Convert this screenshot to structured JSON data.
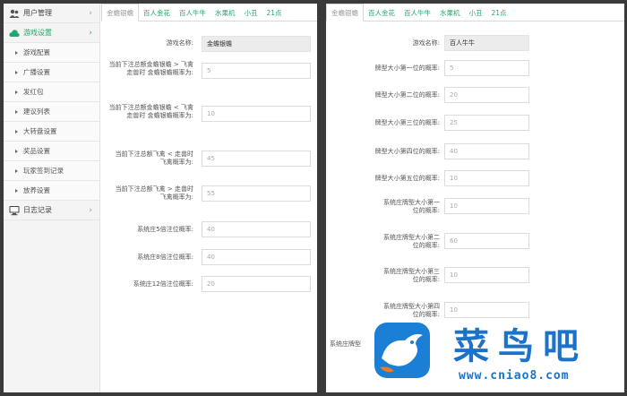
{
  "sidebar": {
    "items": [
      {
        "label": "用户管理",
        "icon": "users-icon"
      },
      {
        "label": "游戏设置",
        "icon": "cloud-icon",
        "active": true
      },
      {
        "label": "日志记录",
        "icon": "monitor-icon"
      }
    ],
    "sub_items": [
      "游戏配置",
      "广播设置",
      "发红包",
      "建议列表",
      "大转盘设置",
      "奖品设置",
      "玩家签到记录",
      "放养设置"
    ]
  },
  "left_panel": {
    "tabs": [
      "金蟾银蟾",
      "百人金花",
      "百人牛牛",
      "水果机",
      "小丑",
      "21点"
    ],
    "active_tab": 0,
    "fields": [
      {
        "label": "游戏名称:",
        "value": "金蟾银蟾",
        "readonly": true
      },
      {
        "label": "当前下注总额金蟾银蟾 > 飞禽走兽时 金蟾银蟾概率为:",
        "value": "5"
      },
      {
        "label": "当前下注总额金蟾银蟾 < 飞禽走兽时 金蟾银蟾概率为:",
        "value": "10"
      },
      {
        "label": "当前下注总额飞禽 < 走兽时 飞禽概率为:",
        "value": "45"
      },
      {
        "label": "当前下注总额飞禽 > 走兽时 飞禽概率为:",
        "value": "55"
      },
      {
        "label": "系统庄5倍注位概率:",
        "value": "40"
      },
      {
        "label": "系统庄8倍注位概率:",
        "value": "40"
      },
      {
        "label": "系统庄12倍注位概率:",
        "value": "20"
      }
    ]
  },
  "right_panel": {
    "tabs": [
      "金蟾银蟾",
      "百人金花",
      "百人牛牛",
      "水果机",
      "小丑",
      "21点"
    ],
    "active_tab": 0,
    "fields": [
      {
        "label": "游戏名称:",
        "value": "百人牛牛",
        "readonly": true
      },
      {
        "label": "牌型大小第一位的概率:",
        "value": "5"
      },
      {
        "label": "牌型大小第二位的概率:",
        "value": "20"
      },
      {
        "label": "牌型大小第三位的概率:",
        "value": "25"
      },
      {
        "label": "牌型大小第四位的概率:",
        "value": "40"
      },
      {
        "label": "牌型大小第五位的概率:",
        "value": "10"
      },
      {
        "label": "系统庄牌型大小第一位的概率:",
        "value": "10"
      },
      {
        "label": "系统庄牌型大小第二位的概率:",
        "value": "60"
      },
      {
        "label": "系统庄牌型大小第三位的概率:",
        "value": "10"
      },
      {
        "label": "系统庄牌型大小第四位的概率:",
        "value": "10"
      },
      {
        "label": "系统庄牌型",
        "value": ""
      }
    ]
  },
  "watermark": {
    "title": "菜鸟吧",
    "url": "www.cniao8.com"
  },
  "colors": {
    "accent": "#22a86a",
    "watermark": "#1b72c8",
    "badge": "#1b7fd6"
  }
}
